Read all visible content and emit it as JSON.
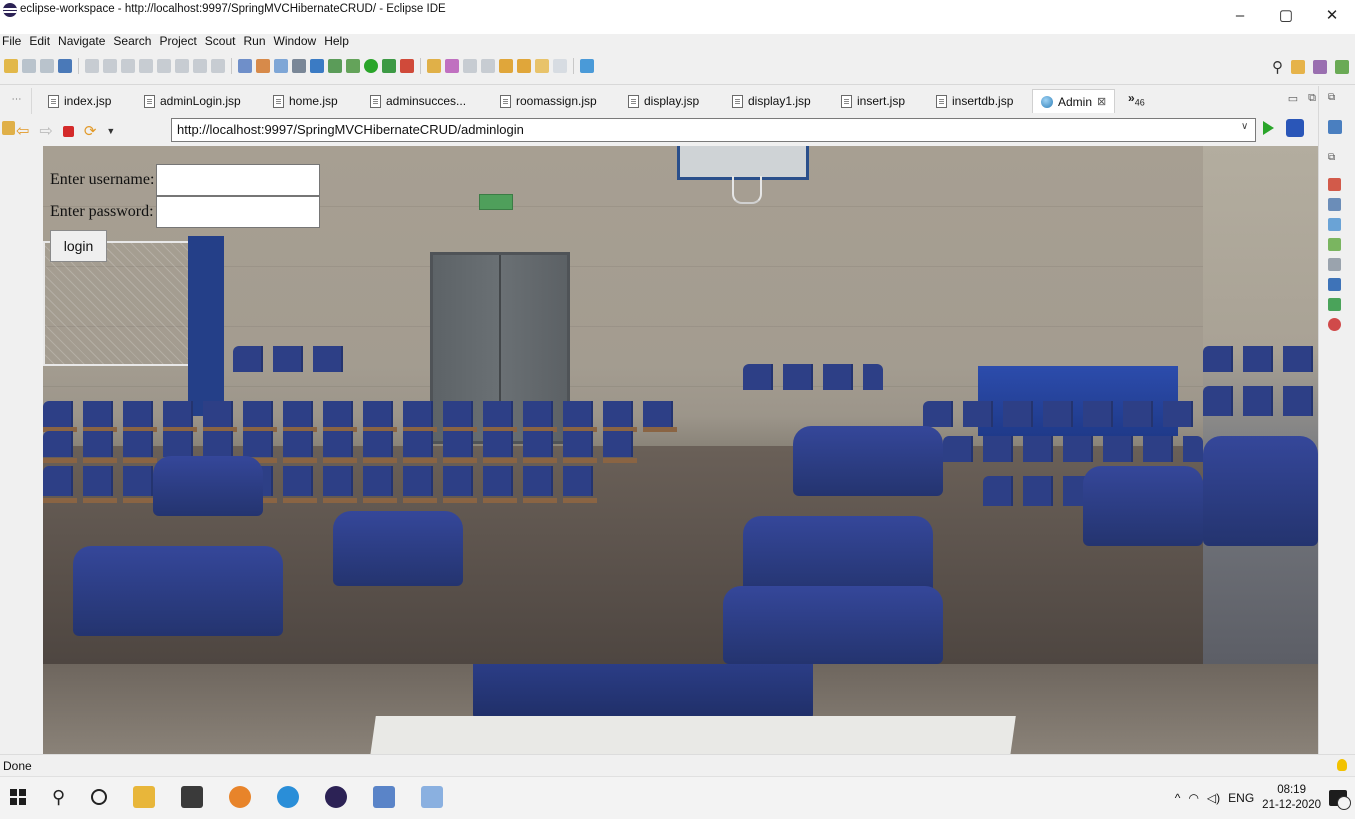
{
  "window": {
    "title": "eclipse-workspace - http://localhost:9997/SpringMVCHibernateCRUD/ - Eclipse IDE",
    "minimize_glyph": "–",
    "maximize_glyph": "▢",
    "close_glyph": "✕"
  },
  "menu": [
    "File",
    "Edit",
    "Navigate",
    "Search",
    "Project",
    "Scout",
    "Run",
    "Window",
    "Help"
  ],
  "tabs": [
    {
      "label": "index.jsp"
    },
    {
      "label": "adminLogin.jsp"
    },
    {
      "label": "home.jsp"
    },
    {
      "label": "adminsucces..."
    },
    {
      "label": "roomassign.jsp"
    },
    {
      "label": "display.jsp"
    },
    {
      "label": "display1.jsp"
    },
    {
      "label": "insert.jsp"
    },
    {
      "label": "insertdb.jsp"
    }
  ],
  "active_tab": {
    "label": "Admin",
    "close_glyph": "⊠"
  },
  "tab_overflow": {
    "glyph": "»",
    "count": "46"
  },
  "browser": {
    "url": "http://localhost:9997/SpringMVCHibernateCRUD/adminlogin"
  },
  "login_form": {
    "username_label": "Enter username:",
    "password_label": "Enter password:",
    "login_button": "login"
  },
  "status": {
    "text": "Done"
  },
  "taskbar": {
    "tray_chevron": "^",
    "language": "ENG",
    "time": "08:19",
    "date": "21-12-2020"
  },
  "colors": {
    "eclipse_purple": "#2c2255",
    "active_tab_bg": "#ffffff",
    "run_green": "#2aa52a",
    "chair_blue": "#2d3f86"
  }
}
